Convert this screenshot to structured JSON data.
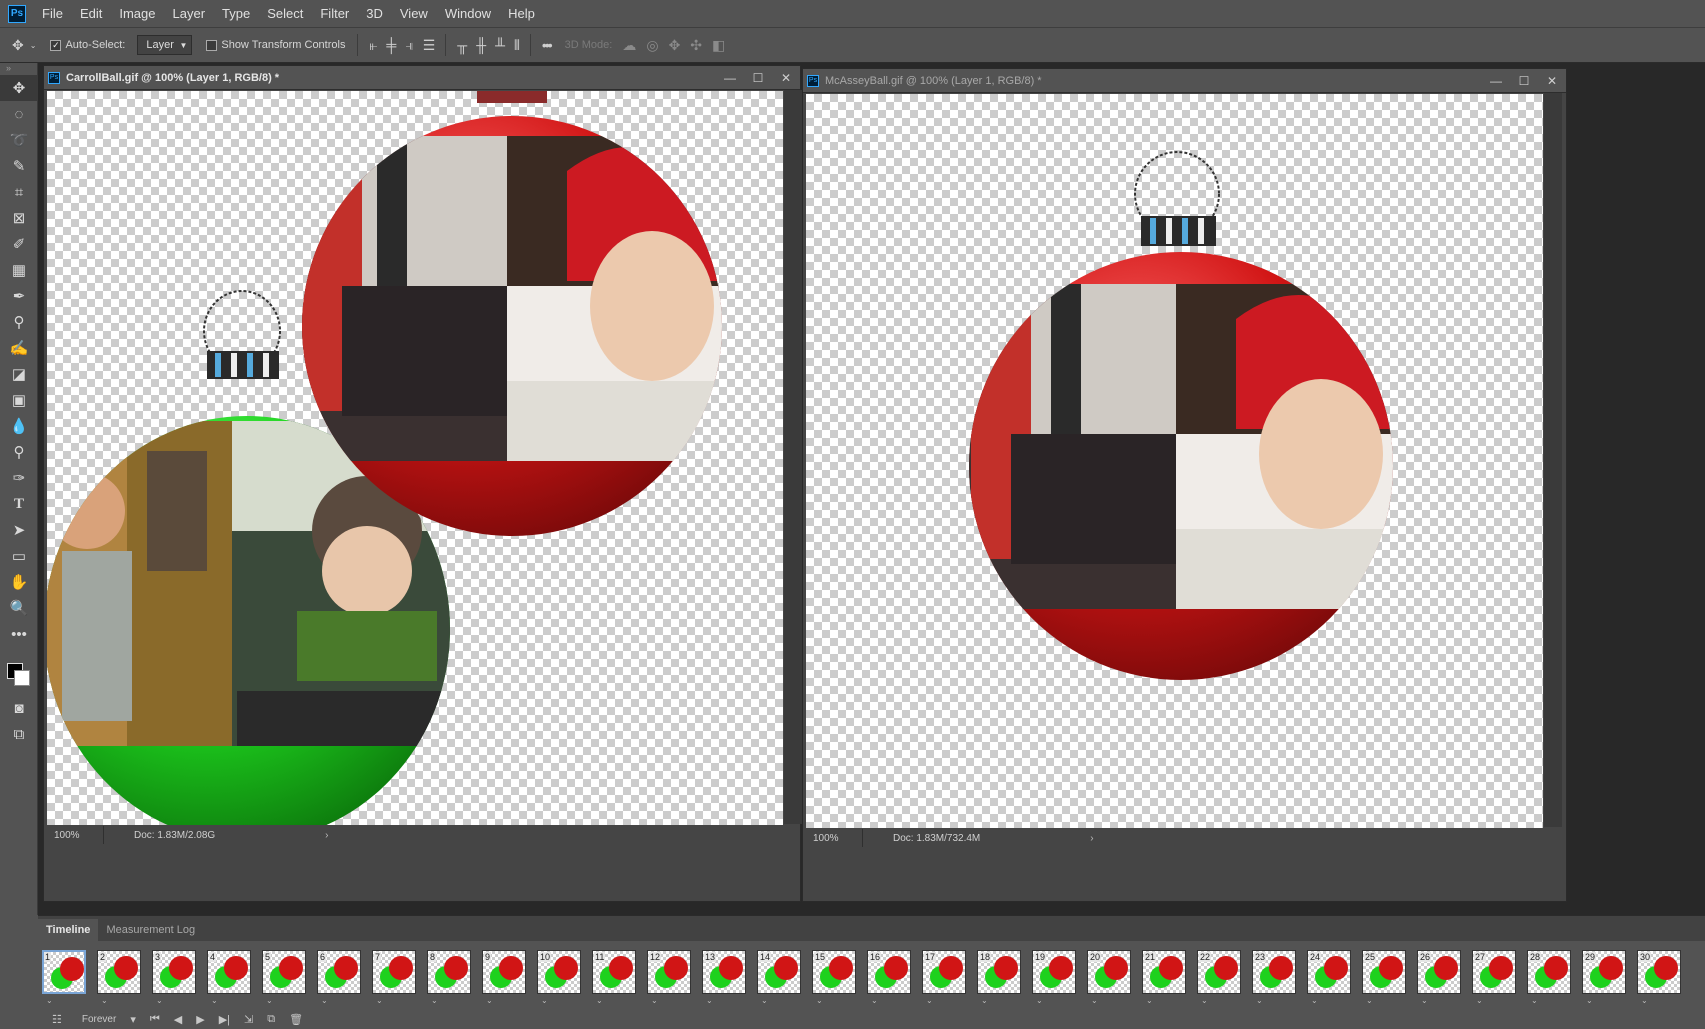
{
  "menu": {
    "app_logo": "Ps",
    "items": [
      "File",
      "Edit",
      "Image",
      "Layer",
      "Type",
      "Select",
      "Filter",
      "3D",
      "View",
      "Window",
      "Help"
    ]
  },
  "options": {
    "auto_select_label": "Auto-Select:",
    "auto_select_checked": true,
    "layer_dropdown": "Layer",
    "show_transform_label": "Show Transform Controls",
    "show_transform_checked": false,
    "mode_3d_label": "3D Mode:"
  },
  "doc_left": {
    "title": "CarrollBall.gif @ 100% (Layer 1, RGB/8) *",
    "zoom": "100%",
    "doc_size": "Doc: 1.83M/2.08G",
    "ornament_color": "#1ed11e",
    "ornament_dark": "#0a6a0a"
  },
  "doc_right": {
    "title": "McAsseyBall.gif @ 100% (Layer 1, RGB/8) *",
    "zoom": "100%",
    "doc_size": "Doc: 1.83M/732.4M"
  },
  "ornament_red": "#d11515",
  "ornament_red_dark": "#6b0808",
  "timeline": {
    "tabs": [
      "Timeline",
      "Measurement Log"
    ],
    "active_tab": "Timeline",
    "loop": "Forever",
    "delay": "0 sec.",
    "frames": [
      "1",
      "2",
      "3",
      "4",
      "5",
      "6",
      "7",
      "8",
      "9",
      "10",
      "11",
      "12",
      "13",
      "14",
      "15",
      "16",
      "17",
      "18",
      "19",
      "20",
      "21",
      "22",
      "23",
      "24",
      "25",
      "26",
      "27",
      "28",
      "29",
      "30"
    ]
  }
}
